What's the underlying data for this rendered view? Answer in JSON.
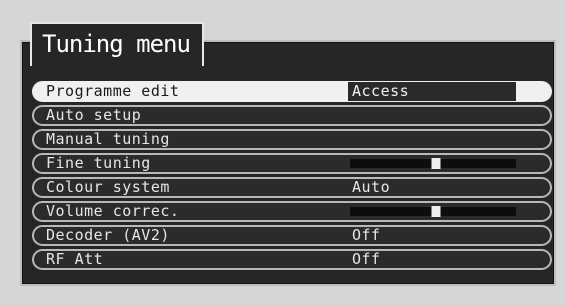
{
  "title": "Tuning menu",
  "items": [
    {
      "label": "Programme edit",
      "type": "value",
      "value": "Access",
      "selected": true
    },
    {
      "label": "Auto setup",
      "type": "none"
    },
    {
      "label": "Manual tuning",
      "type": "none"
    },
    {
      "label": "Fine tuning",
      "type": "slider",
      "level": 0.52
    },
    {
      "label": "Colour system",
      "type": "value",
      "value": "Auto"
    },
    {
      "label": "Volume correc.",
      "type": "slider",
      "level": 0.52
    },
    {
      "label": "Decoder (AV2)",
      "type": "value",
      "value": "Off"
    },
    {
      "label": "RF Att",
      "type": "value",
      "value": "Off"
    }
  ],
  "colors": {
    "panel": "#262626",
    "highlight": "#f0f0f0",
    "text": "#e6e6e6"
  }
}
